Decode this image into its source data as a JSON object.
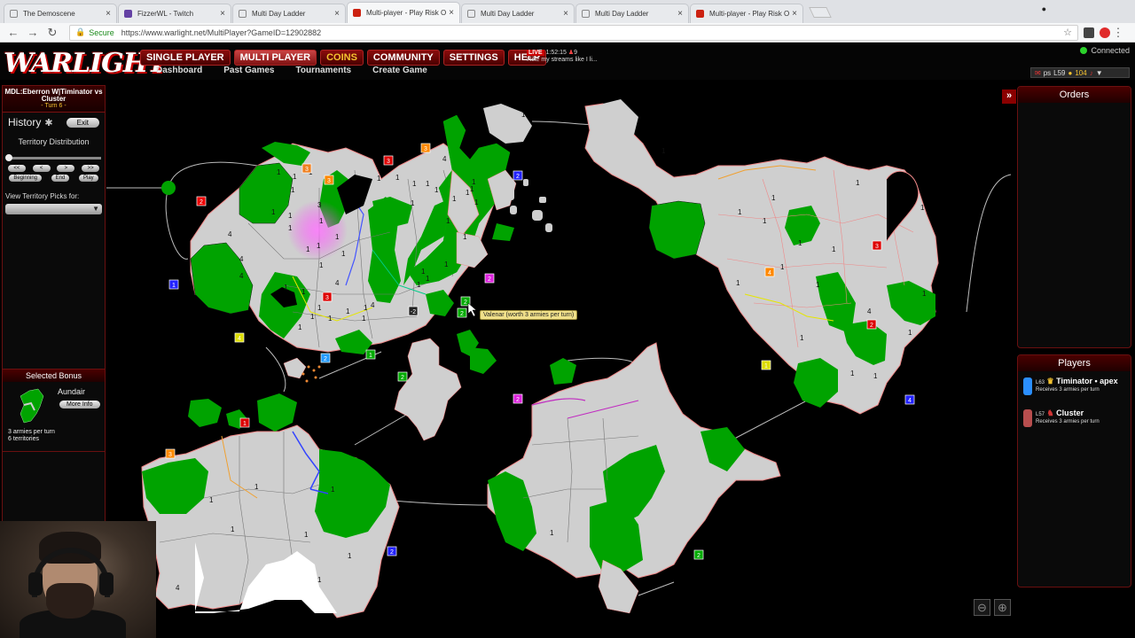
{
  "browser": {
    "tabs": [
      {
        "title": "The Demoscene",
        "icon": "doc"
      },
      {
        "title": "FizzerWL - Twitch",
        "icon": "twitch"
      },
      {
        "title": "Multi Day Ladder",
        "icon": "doc"
      },
      {
        "title": "Multi-player - Play Risk Onl",
        "icon": "warlight"
      },
      {
        "title": "Multi Day Ladder",
        "icon": "doc"
      },
      {
        "title": "Multi Day Ladder",
        "icon": "doc"
      },
      {
        "title": "Multi-player - Play Risk Onl",
        "icon": "warlight"
      }
    ],
    "active_tab": 3,
    "secure_label": "Secure",
    "url": "https://www.warlight.net/MultiPlayer?GameID=12902882"
  },
  "header": {
    "logo": "WARLIGHT",
    "nav": [
      "SINGLE PLAYER",
      "MULTI PLAYER",
      "COINS",
      "COMMUNITY",
      "SETTINGS",
      "HELP"
    ],
    "live_badge": "LIVE",
    "live_line1": "1:52:15",
    "live_count": "9",
    "live_line2": "I like my streams like I li...",
    "subnav": [
      "Dashboard",
      "Past Games",
      "Tournaments",
      "Create Game"
    ],
    "connection": "Connected",
    "user": {
      "name": "ps",
      "level": "L59",
      "coins": "104"
    }
  },
  "left": {
    "game_title": "MDL:Eberron W|Timinator vs Cluster",
    "turn": "- Turn 6 -",
    "history_label": "History",
    "exit_label": "Exit",
    "territory_distribution": "Territory Distribution",
    "step_buttons": [
      "<<",
      "<",
      ">",
      ">>"
    ],
    "play_buttons": [
      "Beginning",
      "End",
      "Play"
    ],
    "view_picks_label": "View Territory Picks for:"
  },
  "bonus": {
    "header": "Selected Bonus",
    "name": "Aundair",
    "more_info": "More Info",
    "armies": "3 armies per turn",
    "territories": "6 territories"
  },
  "map": {
    "tooltip": "Valenar (worth 3 armies per turn)",
    "army_labels": [
      "1",
      "1",
      "1",
      "1",
      "4",
      "4",
      "4",
      "1",
      "1",
      "1",
      "3",
      "1",
      "1",
      "1",
      "1",
      "1",
      "4",
      "1",
      "1",
      "1",
      "1",
      "1",
      "1",
      "1",
      "1",
      "1",
      "1",
      "4",
      "1",
      "1",
      "1",
      "1",
      "1",
      "1",
      "1",
      "1",
      "1",
      "1",
      "1",
      "1",
      "1",
      "1",
      "1",
      "4",
      "1",
      "1",
      "1",
      "1",
      "1",
      "1",
      "1",
      "1",
      "1",
      "1",
      "1",
      "1",
      "1",
      "1",
      "1",
      "4",
      "1",
      "1",
      "1",
      "1",
      "1",
      "1",
      "1",
      "1",
      "1",
      "1",
      "4",
      "1",
      "1"
    ],
    "bonus_markers": [
      "2",
      "3",
      "3",
      "2",
      "3",
      "2",
      "3",
      "1",
      "4",
      "-2",
      "2",
      "2",
      "4",
      "2",
      "1",
      "2",
      "2",
      "3",
      "1",
      "4",
      "3",
      "2",
      "2",
      "1",
      "2",
      "3"
    ]
  },
  "orders": {
    "header": "Orders"
  },
  "players": {
    "header": "Players",
    "list": [
      {
        "level": "L63",
        "name": "Timinator • apex",
        "income": "Receives 3 armies per turn",
        "color": "#2b8fff"
      },
      {
        "level": "L57",
        "name": "Cluster",
        "income": "Receives 3 armies per turn",
        "color": "#b84e4e"
      }
    ]
  },
  "colors": {
    "player1": "#00a300",
    "neutral": "#cfcfcf",
    "accent": "#8b0c0c"
  }
}
